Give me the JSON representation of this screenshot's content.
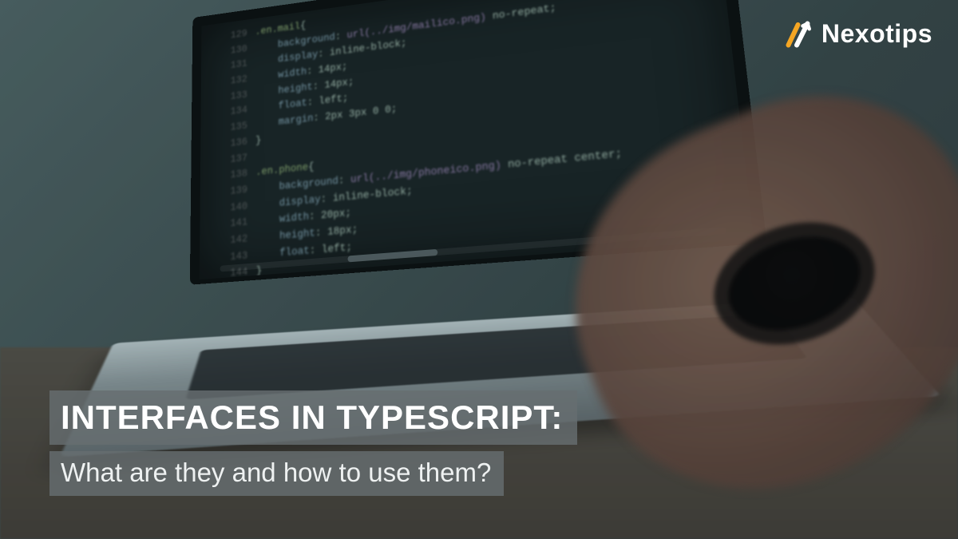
{
  "brand": {
    "name": "Nexotips"
  },
  "title": {
    "main": "INTERFACES IN TYPESCRIPT:",
    "sub": "What are they and how to use them?"
  },
  "code_lines": [
    {
      "n": "129",
      "text": ".en.mail{"
    },
    {
      "n": "130",
      "text": "    background: url(../img/mailico.png) no-repeat;"
    },
    {
      "n": "131",
      "text": "    display: inline-block;"
    },
    {
      "n": "132",
      "text": "    width: 14px;"
    },
    {
      "n": "133",
      "text": "    height: 14px;"
    },
    {
      "n": "134",
      "text": "    float: left;"
    },
    {
      "n": "135",
      "text": "    margin: 2px 3px 0 0;"
    },
    {
      "n": "136",
      "text": "}"
    },
    {
      "n": "137",
      "text": ""
    },
    {
      "n": "138",
      "text": ".en.phone{"
    },
    {
      "n": "139",
      "text": "    background: url(../img/phoneico.png) no-repeat center;"
    },
    {
      "n": "140",
      "text": "    display: inline-block;"
    },
    {
      "n": "141",
      "text": "    width: 20px;"
    },
    {
      "n": "142",
      "text": "    height: 18px;"
    },
    {
      "n": "143",
      "text": "    float: left;"
    },
    {
      "n": "144",
      "text": "}"
    }
  ]
}
